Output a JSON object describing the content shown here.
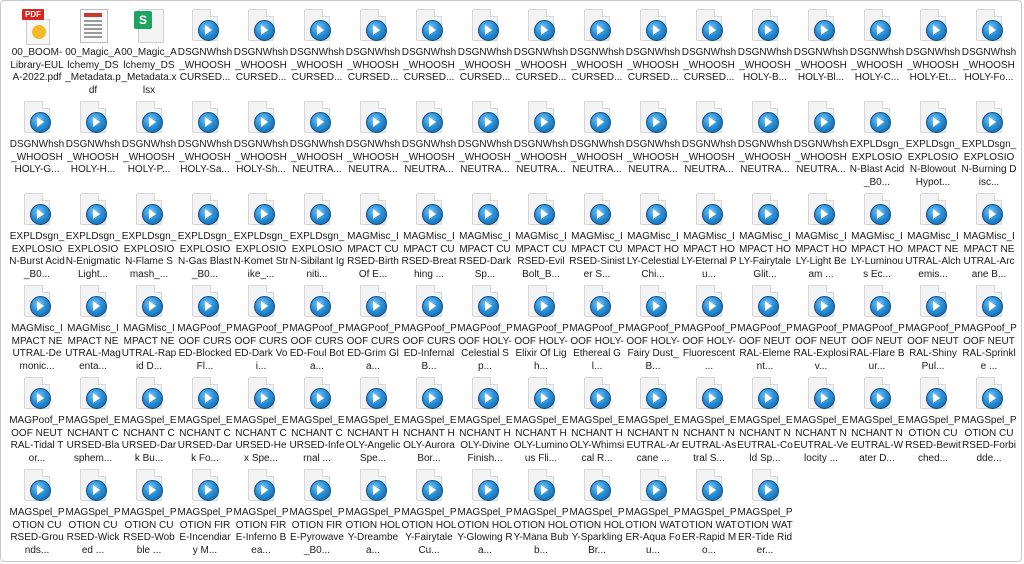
{
  "accent_color": "#2a8fd6",
  "files": [
    {
      "label": "00_BOOM-Library-EULA-2022.pdf",
      "icon": "pdf-file-icon"
    },
    {
      "label": "00_Magic_Alchemy_DS_Metadata.pdf",
      "icon": "document-thumbnail-icon"
    },
    {
      "label": "00_Magic_Alchemy_DS_Metadata.xlsx",
      "icon": "spreadsheet-file-icon"
    },
    {
      "label": "DSGNWhsh_WHOOSH CURSED...",
      "icon": "audio-file-icon"
    },
    {
      "label": "DSGNWhsh_WHOOSH CURSED...",
      "icon": "audio-file-icon"
    },
    {
      "label": "DSGNWhsh_WHOOSH CURSED...",
      "icon": "audio-file-icon"
    },
    {
      "label": "DSGNWhsh_WHOOSH CURSED...",
      "icon": "audio-file-icon"
    },
    {
      "label": "DSGNWhsh_WHOOSH CURSED...",
      "icon": "audio-file-icon"
    },
    {
      "label": "DSGNWhsh_WHOOSH CURSED...",
      "icon": "audio-file-icon"
    },
    {
      "label": "DSGNWhsh_WHOOSH CURSED...",
      "icon": "audio-file-icon"
    },
    {
      "label": "DSGNWhsh_WHOOSH CURSED...",
      "icon": "audio-file-icon"
    },
    {
      "label": "DSGNWhsh_WHOOSH CURSED...",
      "icon": "audio-file-icon"
    },
    {
      "label": "DSGNWhsh_WHOOSH CURSED...",
      "icon": "audio-file-icon"
    },
    {
      "label": "DSGNWhsh_WHOOSH HOLY-B...",
      "icon": "audio-file-icon"
    },
    {
      "label": "DSGNWhsh_WHOOSH HOLY-Bl...",
      "icon": "audio-file-icon"
    },
    {
      "label": "DSGNWhsh_WHOOSH HOLY-C...",
      "icon": "audio-file-icon"
    },
    {
      "label": "DSGNWhsh_WHOOSH HOLY-Et...",
      "icon": "audio-file-icon"
    },
    {
      "label": "DSGNWhsh_WHOOSH HOLY-Fo...",
      "icon": "audio-file-icon"
    },
    {
      "label": "DSGNWhsh_WHOOSH HOLY-G...",
      "icon": "audio-file-icon"
    },
    {
      "label": "DSGNWhsh_WHOOSH HOLY-H...",
      "icon": "audio-file-icon"
    },
    {
      "label": "DSGNWhsh_WHOOSH HOLY-P...",
      "icon": "audio-file-icon"
    },
    {
      "label": "DSGNWhsh_WHOOSH HOLY-Sa...",
      "icon": "audio-file-icon"
    },
    {
      "label": "DSGNWhsh_WHOOSH HOLY-Sh...",
      "icon": "audio-file-icon"
    },
    {
      "label": "DSGNWhsh_WHOOSH NEUTRA...",
      "icon": "audio-file-icon"
    },
    {
      "label": "DSGNWhsh_WHOOSH NEUTRA...",
      "icon": "audio-file-icon"
    },
    {
      "label": "DSGNWhsh_WHOOSH NEUTRA...",
      "icon": "audio-file-icon"
    },
    {
      "label": "DSGNWhsh_WHOOSH NEUTRA...",
      "icon": "audio-file-icon"
    },
    {
      "label": "DSGNWhsh_WHOOSH NEUTRA...",
      "icon": "audio-file-icon"
    },
    {
      "label": "DSGNWhsh_WHOOSH NEUTRA...",
      "icon": "audio-file-icon"
    },
    {
      "label": "DSGNWhsh_WHOOSH NEUTRA...",
      "icon": "audio-file-icon"
    },
    {
      "label": "DSGNWhsh_WHOOSH NEUTRA...",
      "icon": "audio-file-icon"
    },
    {
      "label": "DSGNWhsh_WHOOSH NEUTRA...",
      "icon": "audio-file-icon"
    },
    {
      "label": "DSGNWhsh_WHOOSH NEUTRA...",
      "icon": "audio-file-icon"
    },
    {
      "label": "EXPLDsgn_EXPLOSION-Blast Acid_B0...",
      "icon": "audio-file-icon"
    },
    {
      "label": "EXPLDsgn_EXPLOSION-Blowout Hypot...",
      "icon": "audio-file-icon"
    },
    {
      "label": "EXPLDsgn_EXPLOSION-Burning Disc...",
      "icon": "audio-file-icon"
    },
    {
      "label": "EXPLDsgn_EXPLOSION-Burst Acid_B0...",
      "icon": "audio-file-icon"
    },
    {
      "label": "EXPLDsgn_EXPLOSION-Enigmatic Light...",
      "icon": "audio-file-icon"
    },
    {
      "label": "EXPLDsgn_EXPLOSION-Flame Smash_...",
      "icon": "audio-file-icon"
    },
    {
      "label": "EXPLDsgn_EXPLOSION-Gas Blast_B0...",
      "icon": "audio-file-icon"
    },
    {
      "label": "EXPLDsgn_EXPLOSION-Komet Strike_...",
      "icon": "audio-file-icon"
    },
    {
      "label": "EXPLDsgn_EXPLOSION-Sibilant Igniti...",
      "icon": "audio-file-icon"
    },
    {
      "label": "MAGMisc_IMPACT CURSED-Birth Of E...",
      "icon": "audio-file-icon"
    },
    {
      "label": "MAGMisc_IMPACT CURSED-Breathing ...",
      "icon": "audio-file-icon"
    },
    {
      "label": "MAGMisc_IMPACT CURSED-Dark Sp...",
      "icon": "audio-file-icon"
    },
    {
      "label": "MAGMisc_IMPACT CURSED-Evil Bolt_B...",
      "icon": "audio-file-icon"
    },
    {
      "label": "MAGMisc_IMPACT CURSED-Sinister S...",
      "icon": "audio-file-icon"
    },
    {
      "label": "MAGMisc_IMPACT HOLY-Celestial Chi...",
      "icon": "audio-file-icon"
    },
    {
      "label": "MAGMisc_IMPACT HOLY-Eternal Pu...",
      "icon": "audio-file-icon"
    },
    {
      "label": "MAGMisc_IMPACT HOLY-Fairytale Glit...",
      "icon": "audio-file-icon"
    },
    {
      "label": "MAGMisc_IMPACT HOLY-Light Beam ...",
      "icon": "audio-file-icon"
    },
    {
      "label": "MAGMisc_IMPACT HOLY-Luminous Ec...",
      "icon": "audio-file-icon"
    },
    {
      "label": "MAGMisc_IMPACT NEUTRAL-Alchemis...",
      "icon": "audio-file-icon"
    },
    {
      "label": "MAGMisc_IMPACT NEUTRAL-Arcane B...",
      "icon": "audio-file-icon"
    },
    {
      "label": "MAGMisc_IMPACT NEUTRAL-Demonic...",
      "icon": "audio-file-icon"
    },
    {
      "label": "MAGMisc_IMPACT NEUTRAL-Magenta...",
      "icon": "audio-file-icon"
    },
    {
      "label": "MAGMisc_IMPACT NEUTRAL-Rapid D...",
      "icon": "audio-file-icon"
    },
    {
      "label": "MAGPoof_POOF CURSED-Blocked Fl...",
      "icon": "audio-file-icon"
    },
    {
      "label": "MAGPoof_POOF CURSED-Dark Voi...",
      "icon": "audio-file-icon"
    },
    {
      "label": "MAGPoof_POOF CURSED-Foul Bota...",
      "icon": "audio-file-icon"
    },
    {
      "label": "MAGPoof_POOF CURSED-Grim Gla...",
      "icon": "audio-file-icon"
    },
    {
      "label": "MAGPoof_POOF CURSED-Infernal B...",
      "icon": "audio-file-icon"
    },
    {
      "label": "MAGPoof_POOF HOLY-Celestial Sp...",
      "icon": "audio-file-icon"
    },
    {
      "label": "MAGPoof_POOF HOLY-Elixir Of Ligh...",
      "icon": "audio-file-icon"
    },
    {
      "label": "MAGPoof_POOF HOLY-Ethereal Gl...",
      "icon": "audio-file-icon"
    },
    {
      "label": "MAGPoof_POOF HOLY-Fairy Dust_B...",
      "icon": "audio-file-icon"
    },
    {
      "label": "MAGPoof_POOF HOLY-Fluorescent ...",
      "icon": "audio-file-icon"
    },
    {
      "label": "MAGPoof_POOF NEUTRAL-Element...",
      "icon": "audio-file-icon"
    },
    {
      "label": "MAGPoof_POOF NEUTRAL-Explosiv...",
      "icon": "audio-file-icon"
    },
    {
      "label": "MAGPoof_POOF NEUTRAL-Flare Bur...",
      "icon": "audio-file-icon"
    },
    {
      "label": "MAGPoof_POOF NEUTRAL-Shiny Pul...",
      "icon": "audio-file-icon"
    },
    {
      "label": "MAGPoof_POOF NEUTRAL-Sprinkle ...",
      "icon": "audio-file-icon"
    },
    {
      "label": "MAGPoof_POOF NEUTRAL-Tidal Tor...",
      "icon": "audio-file-icon"
    },
    {
      "label": "MAGSpel_ENCHANT CURSED-Blasphem...",
      "icon": "audio-file-icon"
    },
    {
      "label": "MAGSpel_ENCHANT CURSED-Dark Bu...",
      "icon": "audio-file-icon"
    },
    {
      "label": "MAGSpel_ENCHANT CURSED-Dark Fo...",
      "icon": "audio-file-icon"
    },
    {
      "label": "MAGSpel_ENCHANT CURSED-Hex Spe...",
      "icon": "audio-file-icon"
    },
    {
      "label": "MAGSpel_ENCHANT CURSED-Infernal ...",
      "icon": "audio-file-icon"
    },
    {
      "label": "MAGSpel_ENCHANT HOLY-Angelic Spe...",
      "icon": "audio-file-icon"
    },
    {
      "label": "MAGSpel_ENCHANT HOLY-Aurora Bor...",
      "icon": "audio-file-icon"
    },
    {
      "label": "MAGSpel_ENCHANT HOLY-Divine Finish...",
      "icon": "audio-file-icon"
    },
    {
      "label": "MAGSpel_ENCHANT HOLY-Luminous Fli...",
      "icon": "audio-file-icon"
    },
    {
      "label": "MAGSpel_ENCHANT HOLY-Whimsical R...",
      "icon": "audio-file-icon"
    },
    {
      "label": "MAGSpel_ENCHANT NEUTRAL-Arcane ...",
      "icon": "audio-file-icon"
    },
    {
      "label": "MAGSpel_ENCHANT NEUTRAL-Astral S...",
      "icon": "audio-file-icon"
    },
    {
      "label": "MAGSpel_ENCHANT NEUTRAL-Cold Sp...",
      "icon": "audio-file-icon"
    },
    {
      "label": "MAGSpel_ENCHANT NEUTRAL-Velocity ...",
      "icon": "audio-file-icon"
    },
    {
      "label": "MAGSpel_ENCHANT NEUTRAL-Water D...",
      "icon": "audio-file-icon"
    },
    {
      "label": "MAGSpel_POTION CURSED-Bewitched...",
      "icon": "audio-file-icon"
    },
    {
      "label": "MAGSpel_POTION CURSED-Forbidde...",
      "icon": "audio-file-icon"
    },
    {
      "label": "MAGSpel_POTION CURSED-Grounds...",
      "icon": "audio-file-icon"
    },
    {
      "label": "MAGSpel_POTION CURSED-Wicked ...",
      "icon": "audio-file-icon"
    },
    {
      "label": "MAGSpel_POTION CURSED-Wobble ...",
      "icon": "audio-file-icon"
    },
    {
      "label": "MAGSpel_POTION FIRE-Incendiary M...",
      "icon": "audio-file-icon"
    },
    {
      "label": "MAGSpel_POTION FIRE-Inferno Bea...",
      "icon": "audio-file-icon"
    },
    {
      "label": "MAGSpel_POTION FIRE-Pyrowave_B0...",
      "icon": "audio-file-icon"
    },
    {
      "label": "MAGSpel_POTION HOLY-Dreambea...",
      "icon": "audio-file-icon"
    },
    {
      "label": "MAGSpel_POTION HOLY-Fairytale Cu...",
      "icon": "audio-file-icon"
    },
    {
      "label": "MAGSpel_POTION HOLY-Glowing Ra...",
      "icon": "audio-file-icon"
    },
    {
      "label": "MAGSpel_POTION HOLY-Mana Bubb...",
      "icon": "audio-file-icon"
    },
    {
      "label": "MAGSpel_POTION HOLY-Sparkling Br...",
      "icon": "audio-file-icon"
    },
    {
      "label": "MAGSpel_POTION WATER-Aqua Fou...",
      "icon": "audio-file-icon"
    },
    {
      "label": "MAGSpel_POTION WATER-Rapid Mo...",
      "icon": "audio-file-icon"
    },
    {
      "label": "MAGSpel_POTION WATER-Tide Rider...",
      "icon": "audio-file-icon"
    }
  ]
}
